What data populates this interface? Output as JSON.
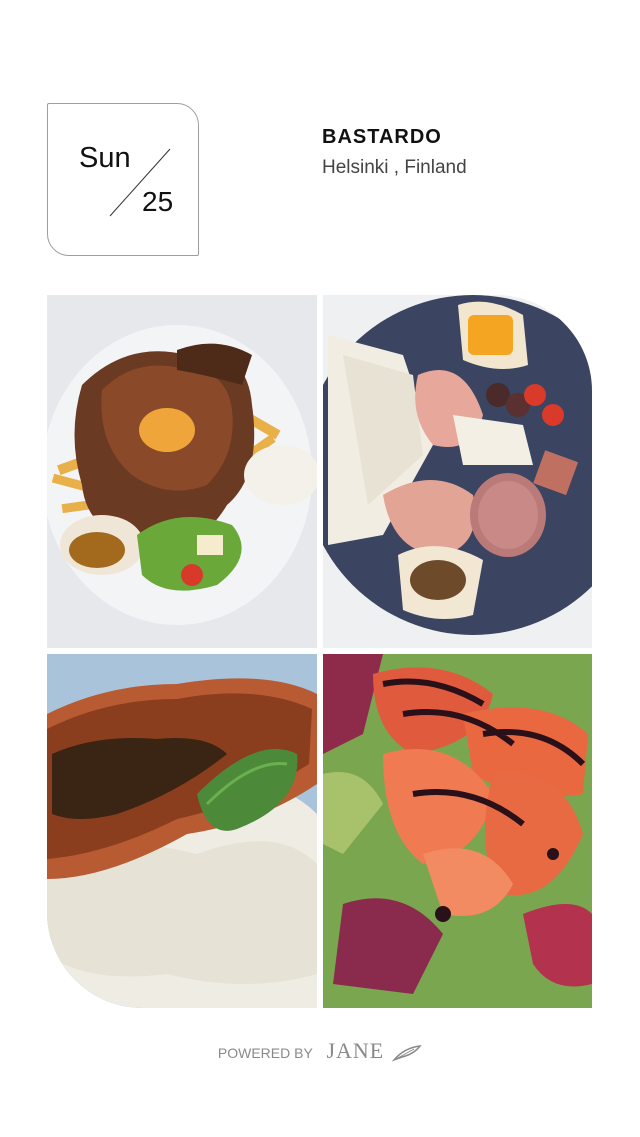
{
  "date": {
    "day": "Sun",
    "number": "25"
  },
  "venue": {
    "name": "BASTARDO",
    "location": "Helsinki , Finland"
  },
  "photos": [
    {
      "name": "steak-plate-photo"
    },
    {
      "name": "charcuterie-board-photo"
    },
    {
      "name": "salmon-dish-photo"
    },
    {
      "name": "prosciutto-salad-photo"
    }
  ],
  "footer": {
    "powered_by": "POWERED BY",
    "brand": "JANE",
    "brand_icon": "feather-icon"
  }
}
